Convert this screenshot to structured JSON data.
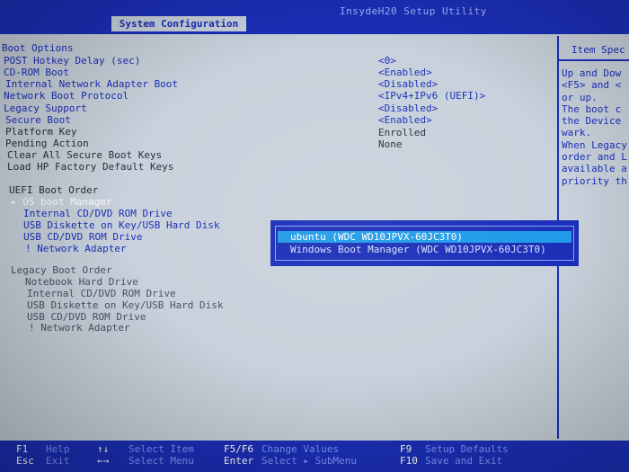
{
  "utility_title": "InsydeH20 Setup Utility",
  "active_tab": "System Configuration",
  "help": {
    "title": "Item Spec",
    "lines": [
      "Up and Dow",
      "<F5> and <",
      "or up.",
      "The boot c",
      "the Device",
      "wark.",
      "When Legacy",
      "order and L",
      "available a",
      "priority th"
    ]
  },
  "boot_options": {
    "heading": "Boot Options",
    "items": [
      {
        "label": "POST Hotkey Delay (sec)",
        "value": "<0>"
      },
      {
        "label": "CD-ROM Boot",
        "value": "<Enabled>"
      },
      {
        "label": "Internal Network Adapter Boot",
        "value": "<Disabled>"
      },
      {
        "label": "Network Boot Protocol",
        "value": "<IPv4+IPv6 (UEFI)>"
      },
      {
        "label": "Legacy Support",
        "value": "<Disabled>"
      },
      {
        "label": "Secure Boot",
        "value": "<Enabled>"
      },
      {
        "label": "Platform Key",
        "value": "Enrolled"
      },
      {
        "label": "Pending Action",
        "value": "None"
      },
      {
        "label": "Clear All Secure Boot Keys",
        "value": ""
      },
      {
        "label": "Load HP Factory Default Keys",
        "value": ""
      }
    ]
  },
  "uefi_boot_order": {
    "heading": "UEFI Boot Order",
    "items": [
      "▸ OS boot Manager",
      "Internal CD/DVD ROM Drive",
      "USB Diskette on Key/USB Hard Disk",
      "USB CD/DVD ROM Drive",
      "! Network Adapter"
    ]
  },
  "legacy_boot_order": {
    "heading": "Legacy Boot Order",
    "items": [
      "Notebook Hard Drive",
      "Internal CD/DVD ROM Drive",
      "USB Diskette on Key/USB Hard Disk",
      "USB CD/DVD ROM Drive",
      "! Network Adapter"
    ]
  },
  "popup": {
    "options": [
      "ubuntu (WDC WD10JPVX-60JC3T0)",
      "Windows Boot Manager (WDC WD10JPVX-60JC3T0)"
    ],
    "selected_index": 0
  },
  "keys": {
    "row1": [
      {
        "key": "F1",
        "desc": "Help"
      },
      {
        "key": "↑↓",
        "desc": "Select Item"
      },
      {
        "key": "F5/F6",
        "desc": "Change Values"
      },
      {
        "key": "F9",
        "desc": "Setup Defaults"
      }
    ],
    "row2": [
      {
        "key": "Esc",
        "desc": "Exit"
      },
      {
        "key": "←→",
        "desc": "Select Menu"
      },
      {
        "key": "Enter",
        "desc": "Select ▸ SubMenu"
      },
      {
        "key": "F10",
        "desc": "Save and Exit"
      }
    ]
  },
  "colors": {
    "bios_blue": "#1b2fb8",
    "panel_grey": "#c9d2dc",
    "highlight_cyan": "#1f9be8"
  }
}
